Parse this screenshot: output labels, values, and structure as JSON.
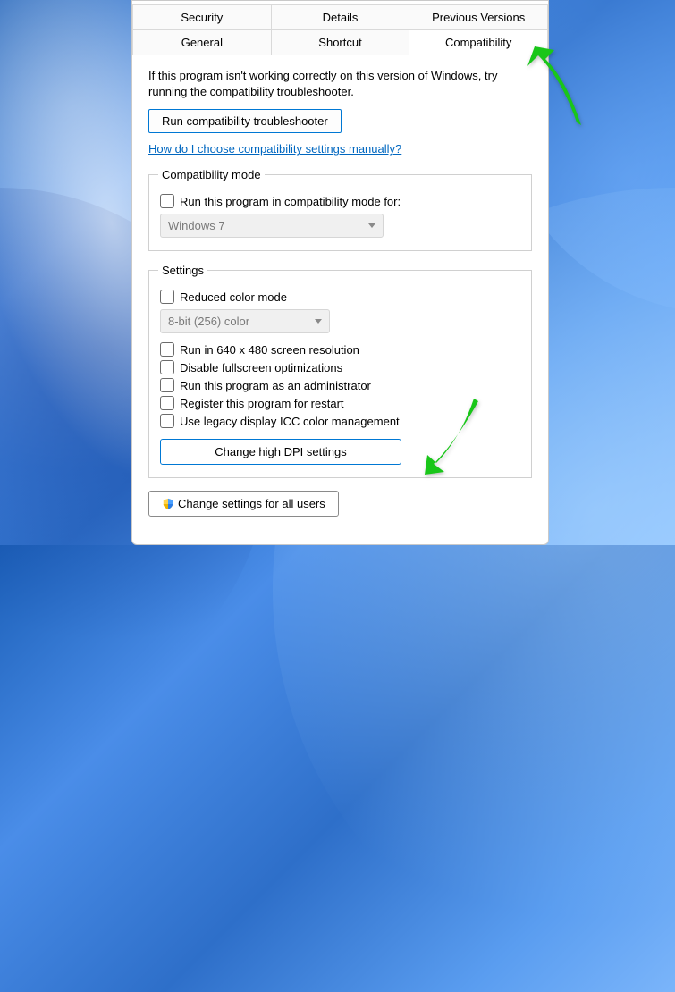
{
  "tabs": {
    "row1": [
      "Security",
      "Details",
      "Previous Versions"
    ],
    "row2": [
      "General",
      "Shortcut",
      "Compatibility"
    ],
    "active": "Compatibility"
  },
  "intro": "If this program isn't working correctly on this version of Windows, try running the compatibility troubleshooter.",
  "run_troubleshooter": "Run compatibility troubleshooter",
  "help_link": "How do I choose compatibility settings manually?",
  "compat_group": {
    "legend": "Compatibility mode",
    "checkbox_label": "Run this program in compatibility mode for:",
    "dropdown_value": "Windows 7"
  },
  "settings_group": {
    "legend": "Settings",
    "reduced_color": "Reduced color mode",
    "color_dropdown": "8-bit (256) color",
    "run_640": "Run in 640 x 480 screen resolution",
    "disable_fullscreen": "Disable fullscreen optimizations",
    "run_admin": "Run this program as an administrator",
    "register_restart": "Register this program for restart",
    "legacy_icc": "Use legacy display ICC color management",
    "dpi_button": "Change high DPI settings"
  },
  "all_users_button": "Change settings for all users"
}
